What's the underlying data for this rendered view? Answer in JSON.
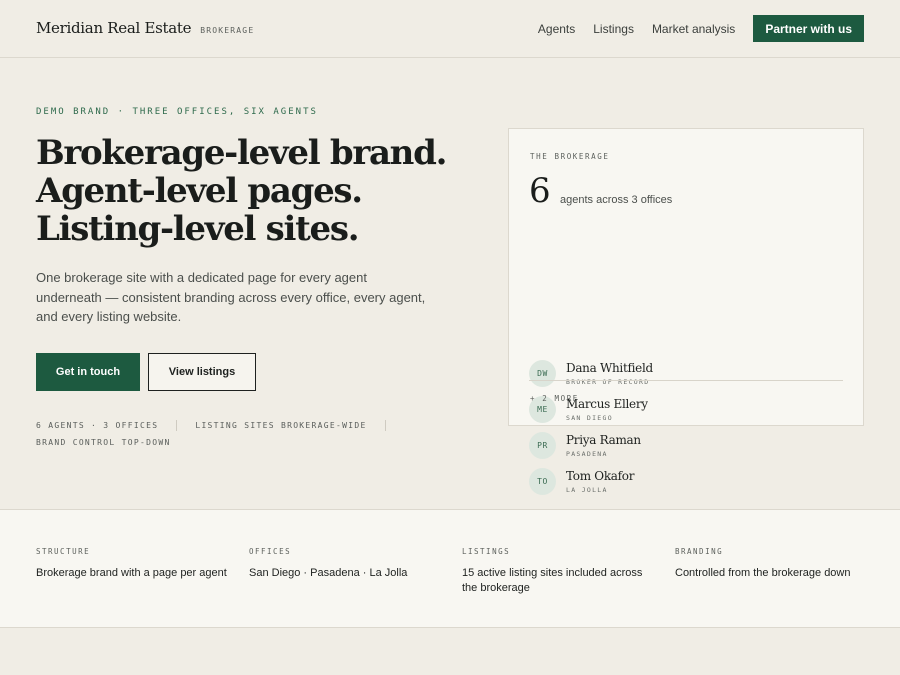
{
  "header": {
    "brand_name": "Meridian Real Estate",
    "brand_tag": "BROKERAGE",
    "nav": [
      "Agents",
      "Listings",
      "Market analysis"
    ],
    "cta": "Partner with us"
  },
  "hero": {
    "eyebrow": "DEMO BRAND · THREE OFFICES, SIX AGENTS",
    "title": "Brokerage-level brand. Agent-level pages. Listing-level sites.",
    "subtitle": "One brokerage site with a dedicated page for every agent underneath — consistent branding across every office, every agent, and every listing website.",
    "primary_button": "Get in touch",
    "secondary_button": "View listings",
    "meta": [
      "6 AGENTS · 3 OFFICES",
      "LISTING SITES BROKERAGE-WIDE",
      "BRAND CONTROL TOP-DOWN"
    ]
  },
  "card": {
    "eyebrow": "THE BROKERAGE",
    "count": "6",
    "count_label": "agents across 3 offices",
    "agents": [
      {
        "initials": "DW",
        "name": "Dana Whitfield",
        "role": "BROKER OF RECORD"
      },
      {
        "initials": "ME",
        "name": "Marcus Ellery",
        "role": "SAN DIEGO"
      },
      {
        "initials": "PR",
        "name": "Priya Raman",
        "role": "PASADENA"
      },
      {
        "initials": "TO",
        "name": "Tom Okafor",
        "role": "LA JOLLA"
      }
    ],
    "more": "+ 2 MORE"
  },
  "stats": [
    {
      "label": "STRUCTURE",
      "value": "Brokerage brand with a page per agent"
    },
    {
      "label": "OFFICES",
      "value": "San Diego · Pasadena · La Jolla"
    },
    {
      "label": "LISTINGS",
      "value": "15 active listing sites included across the brokerage"
    },
    {
      "label": "BRANDING",
      "value": "Controlled from the brokerage down"
    }
  ],
  "colors": {
    "accent": "#1d5a40",
    "background": "#f0ede5",
    "surface": "#f8f7f2"
  }
}
